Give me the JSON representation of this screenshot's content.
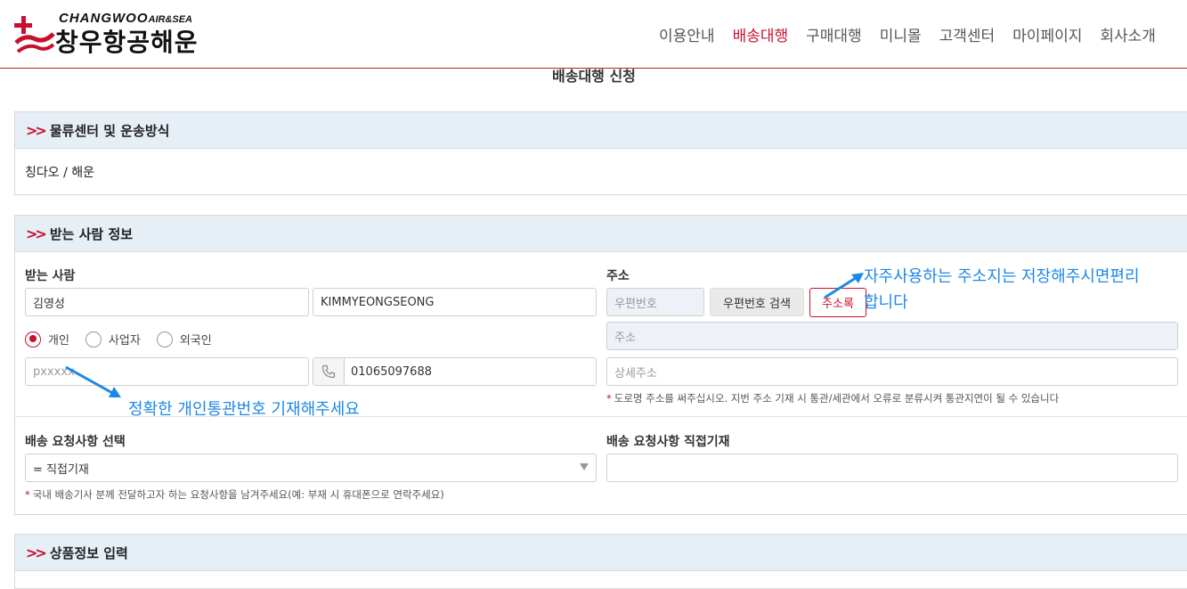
{
  "header": {
    "logo_en": "CHANGWOO",
    "logo_en_small": "AIR&SEA",
    "logo_ko": "창우항공해운",
    "nav": [
      "이용안내",
      "배송대행",
      "구매대행",
      "미니몰",
      "고객센터",
      "마이페이지",
      "회사소개"
    ],
    "active_nav": "배송대행"
  },
  "page_title": "배송대행 신청",
  "section_logistics": {
    "title": "물류센터 및 운송방식",
    "value": "칭다오 / 해운"
  },
  "section_recipient": {
    "title": "받는 사람 정보",
    "recipient_label": "받는 사람",
    "name_ko": "김영성",
    "name_en": "KIMMYEONGSEONG",
    "radios": [
      "개인",
      "사업자",
      "외국인"
    ],
    "selected_radio": "개인",
    "customs_no": "pxxxxx",
    "phone": "01065097688",
    "address_label": "주소",
    "zip_placeholder": "우편번호",
    "zip_search_btn": "우편번호 검색",
    "address_book_btn": "주소록",
    "address_placeholder": "주소",
    "address_detail_placeholder": "상세주소",
    "address_note": "도로명 주소를 써주십시오. 지번 주소 기재 시 통관/세관에서 오류로 분류시켜 통관지연이 될 수 있습니다",
    "request_select_label": "배송 요청사항 선택",
    "request_select_value": "= 직접기재",
    "request_note": "국내 배송기사 분께 전달하고자 하는 요청사항을 남겨주세요(예: 부재 시 휴대폰으로 연락주세요)",
    "request_direct_label": "배송 요청사항 직접기재",
    "request_direct_value": ""
  },
  "section_product": {
    "title": "상품정보 입력"
  },
  "annotations": {
    "address_tip_line1": "자주사용하는 주소지는 저장해주시면편리",
    "address_tip_line2": "합니다",
    "customs_tip": "정확한 개인통관번호 기재해주세요"
  },
  "colors": {
    "accent": "#c8102e",
    "panel_header_bg": "#e6eef6",
    "annotation": "#1e88e5"
  }
}
